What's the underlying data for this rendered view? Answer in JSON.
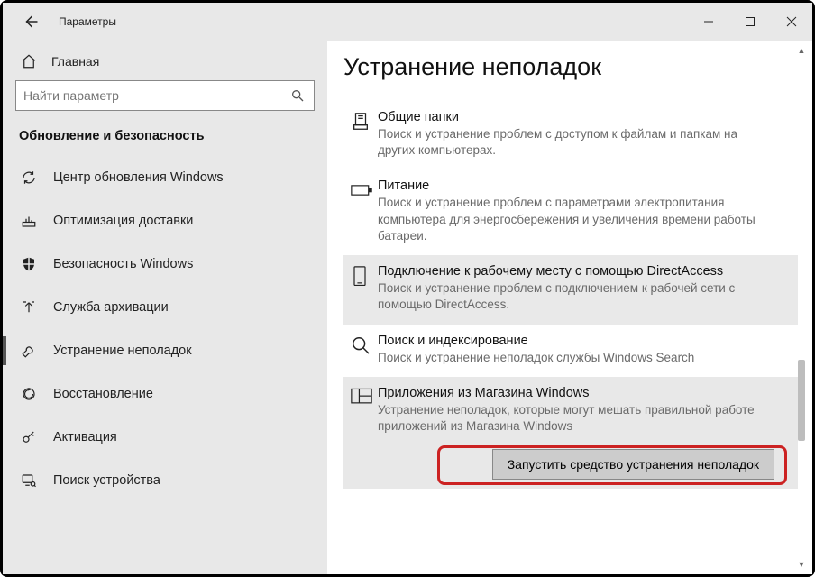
{
  "window": {
    "title": "Параметры",
    "minimize": "—",
    "maximize": "☐",
    "close": "✕"
  },
  "sidebar": {
    "home_label": "Главная",
    "search_placeholder": "Найти параметр",
    "section_title": "Обновление и безопасность",
    "items": [
      {
        "label": "Центр обновления Windows"
      },
      {
        "label": "Оптимизация доставки"
      },
      {
        "label": "Безопасность Windows"
      },
      {
        "label": "Служба архивации"
      },
      {
        "label": "Устранение неполадок"
      },
      {
        "label": "Восстановление"
      },
      {
        "label": "Активация"
      },
      {
        "label": "Поиск устройства"
      }
    ]
  },
  "content": {
    "page_title": "Устранение неполадок",
    "items": [
      {
        "title": "Общие папки",
        "desc": "Поиск и устранение проблем с доступом к файлам и папкам на других компьютерах."
      },
      {
        "title": "Питание",
        "desc": "Поиск и устранение проблем с параметрами электропитания компьютера для энергосбережения и увеличения  времени работы батареи."
      },
      {
        "title": "Подключение к рабочему месту с помощью DirectAccess",
        "desc": "Поиск и устранение проблем с подключением к рабочей сети с помощью DirectAccess."
      },
      {
        "title": "Поиск и индексирование",
        "desc": "Поиск и устранение неполадок службы Windows Search"
      },
      {
        "title": "Приложения из Магазина Windows",
        "desc": "Устранение неполадок, которые могут мешать правильной работе приложений из Магазина Windows"
      }
    ],
    "run_button": "Запустить средство устранения неполадок"
  }
}
